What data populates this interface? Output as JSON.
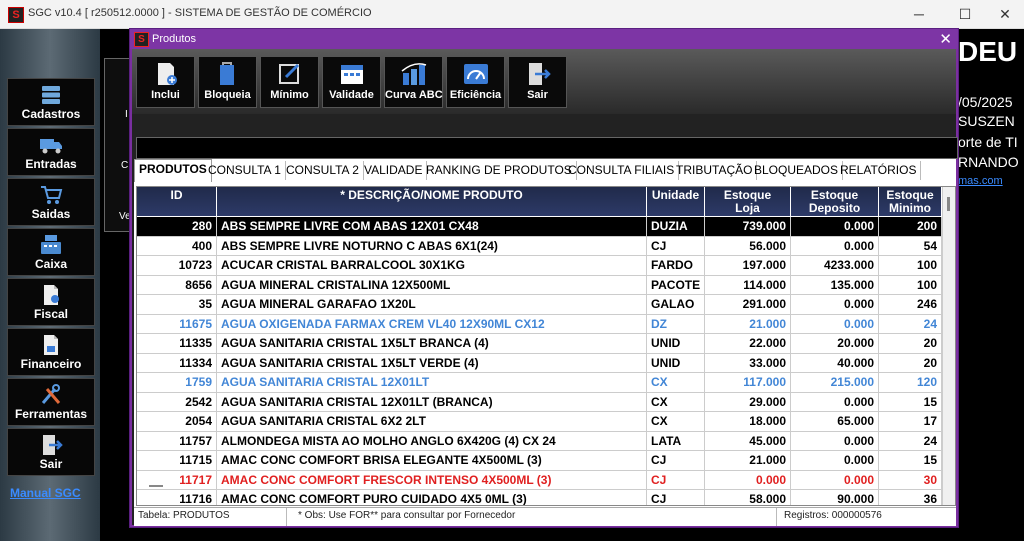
{
  "main_window": {
    "title": "SGC v10.4 [ r250512.0000 ] - SISTEMA DE GESTÃO DE COMÉRCIO",
    "app_icon": "S"
  },
  "window_controls": {
    "minimize": "─",
    "maximize": "☐",
    "close": "✕"
  },
  "sidebar": {
    "items": [
      {
        "label": "Cadastros",
        "icon": "database-icon"
      },
      {
        "label": "Entradas",
        "icon": "truck-icon"
      },
      {
        "label": "Saidas",
        "icon": "cart-icon"
      },
      {
        "label": "Caixa",
        "icon": "cash-register-icon"
      },
      {
        "label": "Fiscal",
        "icon": "document-icon"
      },
      {
        "label": "Financeiro",
        "icon": "finance-document-icon"
      },
      {
        "label": "Ferramentas",
        "icon": "tools-icon"
      },
      {
        "label": "Sair",
        "icon": "exit-icon"
      }
    ],
    "manual_link": "Manual SGC"
  },
  "background": {
    "deu": "DEU",
    "date": "/05/2025",
    "suszen": "SUSZEN",
    "suporte": "orte de TI",
    "nando": "RNANDO",
    "link": "mas.com",
    "left_letters": [
      "I",
      "C",
      "Ve"
    ]
  },
  "produtos_window": {
    "title": "Produtos",
    "icon": "S",
    "close": "✕",
    "toolbar": [
      {
        "label": "Inclui",
        "icon": "add-document-icon"
      },
      {
        "label": "Bloqueia",
        "icon": "lock-document-icon"
      },
      {
        "label": "Mínimo",
        "icon": "edit-minimum-icon"
      },
      {
        "label": "Validade",
        "icon": "calendar-icon"
      },
      {
        "label": "Curva ABC",
        "icon": "buildings-chart-icon"
      },
      {
        "label": "Eficiência",
        "icon": "gauge-icon"
      },
      {
        "label": "Sair",
        "icon": "exit-icon"
      }
    ],
    "tabs": [
      "PRODUTOS",
      "CONSULTA 1",
      "CONSULTA 2",
      "VALIDADE",
      "RANKING DE PRODUTOS",
      "CONSULTA FILIAIS",
      "TRIBUTAÇÃO",
      "BLOQUEADOS",
      "RELATÓRIOS"
    ],
    "columns": [
      {
        "label": "ID"
      },
      {
        "label": "* DESCRIÇÃO/NOME PRODUTO"
      },
      {
        "label": "Unidade"
      },
      {
        "label": "Estoque\nLoja"
      },
      {
        "label": "Estoque\nDeposito"
      },
      {
        "label": "Estoque\nMinimo"
      }
    ],
    "rows": [
      {
        "id": "280",
        "desc": "ABS SEMPRE LIVRE COM ABAS 12X01  CX48",
        "unit": "DUZIA",
        "loja": "739.000",
        "dep": "0.000",
        "min": "200",
        "style": "sel"
      },
      {
        "id": "400",
        "desc": "ABS SEMPRE LIVRE NOTURNO C ABAS 6X1(24)",
        "unit": "CJ",
        "loja": "56.000",
        "dep": "0.000",
        "min": "54",
        "style": ""
      },
      {
        "id": "10723",
        "desc": "ACUCAR CRISTAL BARRALCOOL  30X1KG",
        "unit": "FARDO",
        "loja": "197.000",
        "dep": "4233.000",
        "min": "100",
        "style": ""
      },
      {
        "id": "8656",
        "desc": "AGUA MINERAL CRISTALINA 12X500ML",
        "unit": "PACOTE",
        "loja": "114.000",
        "dep": "135.000",
        "min": "100",
        "style": ""
      },
      {
        "id": "35",
        "desc": "AGUA MINERAL GARAFAO 1X20L",
        "unit": "GALAO",
        "loja": "291.000",
        "dep": "0.000",
        "min": "246",
        "style": ""
      },
      {
        "id": "11675",
        "desc": "AGUA OXIGENADA FARMAX CREM VL40 12X90ML  CX12",
        "unit": "DZ",
        "loja": "21.000",
        "dep": "0.000",
        "min": "24",
        "style": "blue"
      },
      {
        "id": "11335",
        "desc": "AGUA SANITARIA  CRISTAL 1X5LT BRANCA (4)",
        "unit": "UNID",
        "loja": "22.000",
        "dep": "20.000",
        "min": "20",
        "style": ""
      },
      {
        "id": "11334",
        "desc": "AGUA SANITARIA  CRISTAL 1X5LT VERDE (4)",
        "unit": "UNID",
        "loja": "33.000",
        "dep": "40.000",
        "min": "20",
        "style": ""
      },
      {
        "id": "1759",
        "desc": "AGUA SANITARIA CRISTAL 12X01LT",
        "unit": "CX",
        "loja": "117.000",
        "dep": "215.000",
        "min": "120",
        "style": "blue"
      },
      {
        "id": "2542",
        "desc": "AGUA SANITARIA CRISTAL 12X01LT (BRANCA)",
        "unit": "CX",
        "loja": "29.000",
        "dep": "0.000",
        "min": "15",
        "style": ""
      },
      {
        "id": "2054",
        "desc": "AGUA SANITARIA CRISTAL 6X2 2LT",
        "unit": "CX",
        "loja": "18.000",
        "dep": "65.000",
        "min": "17",
        "style": ""
      },
      {
        "id": "11757",
        "desc": "ALMONDEGA MISTA AO MOLHO ANGLO 6X420G (4) CX 24",
        "unit": "LATA",
        "loja": "45.000",
        "dep": "0.000",
        "min": "24",
        "style": ""
      },
      {
        "id": "11715",
        "desc": "AMAC CONC COMFORT BRISA ELEGANTE 4X500ML (3)",
        "unit": "CJ",
        "loja": "21.000",
        "dep": "0.000",
        "min": "15",
        "style": ""
      },
      {
        "id": "11717",
        "desc": "AMAC CONC COMFORT FRESCOR INTENSO  4X500ML (3)",
        "unit": "CJ",
        "loja": "0.000",
        "dep": "0.000",
        "min": "30",
        "style": "red"
      },
      {
        "id": "11716",
        "desc": "AMAC CONC COMFORT PURO CUIDADO  4X5 0ML (3)",
        "unit": "CJ",
        "loja": "58.000",
        "dep": "90.000",
        "min": "36",
        "style": ""
      }
    ],
    "status": {
      "tabela": "Tabela: PRODUTOS",
      "obs": "* Obs: Use FOR** para consultar por Fornecedor",
      "registros": "Registros: 000000576"
    }
  }
}
